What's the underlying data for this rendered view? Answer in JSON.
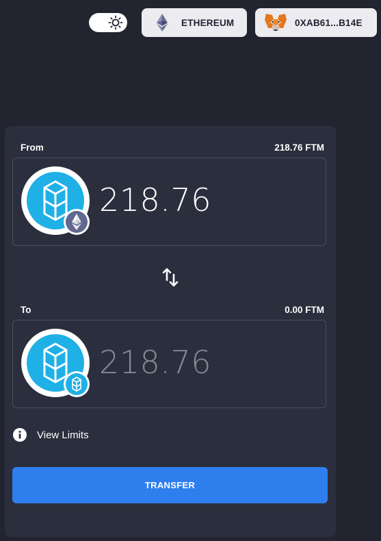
{
  "header": {
    "theme_toggle_icon": "sun-icon",
    "network": {
      "label": "ETHEREUM",
      "icon": "ethereum-icon"
    },
    "wallet": {
      "label": "0XAB61...B14E",
      "icon": "metamask-fox-icon"
    }
  },
  "from": {
    "label": "From",
    "balance": "218.76 FTM",
    "amount": "218.76",
    "token_icon": "fantom-token-icon",
    "chain_badge_icon": "ethereum-badge-icon"
  },
  "swap_icon": "swap-arrows-icon",
  "to": {
    "label": "To",
    "balance": "0.00 FTM",
    "amount": "218.76",
    "token_icon": "fantom-token-icon",
    "chain_badge_icon": "fantom-badge-icon"
  },
  "limits": {
    "label": "View Limits",
    "icon": "info-icon"
  },
  "transfer_button": {
    "label": "TRANSFER"
  },
  "colors": {
    "background": "#222430",
    "card": "#2b2e3d",
    "accent": "#2f7eee",
    "fantom_blue": "#1fb0e6",
    "pill": "#ececf0"
  }
}
